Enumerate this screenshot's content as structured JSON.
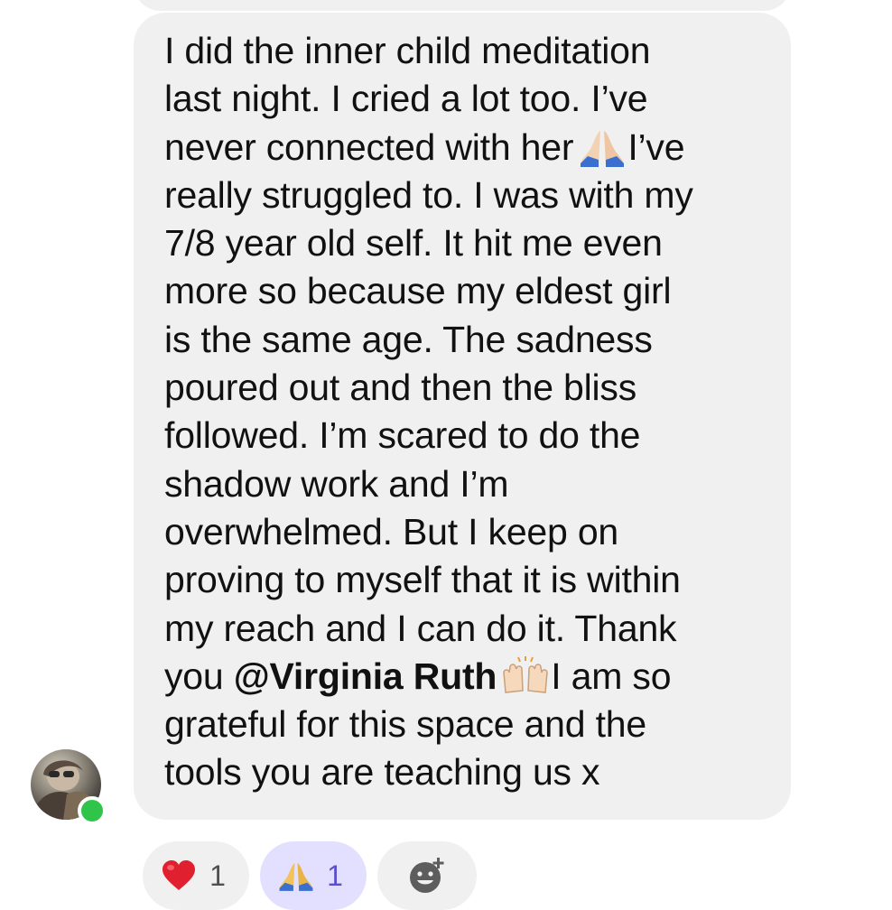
{
  "message": {
    "lines": [
      "I did the inner child meditation",
      "last night. I cried a lot too. I’ve",
      "never connected with her",
      "I’ve",
      "really struggled to. I was with my",
      "7/8 year old self. It hit me even",
      "more so because my eldest girl",
      "is the same age. The sadness",
      "poured out and then the bliss",
      "followed. I’m scared to do the",
      "shadow work and I’m",
      "overwhelmed. But I keep on",
      "proving to myself that it is within",
      "my reach and I can do it. Thank",
      "you",
      "@Virginia Ruth",
      "I am so",
      "grateful for this space and the",
      "tools you are teaching us x"
    ]
  },
  "reactions": [
    {
      "icon": "heart-icon",
      "count": "1"
    },
    {
      "icon": "folded-hands-icon",
      "count": "1"
    }
  ],
  "colors": {
    "bubble": "#f0f0f0",
    "selected_reaction": "#e3e0ff",
    "online": "#31c44a"
  }
}
